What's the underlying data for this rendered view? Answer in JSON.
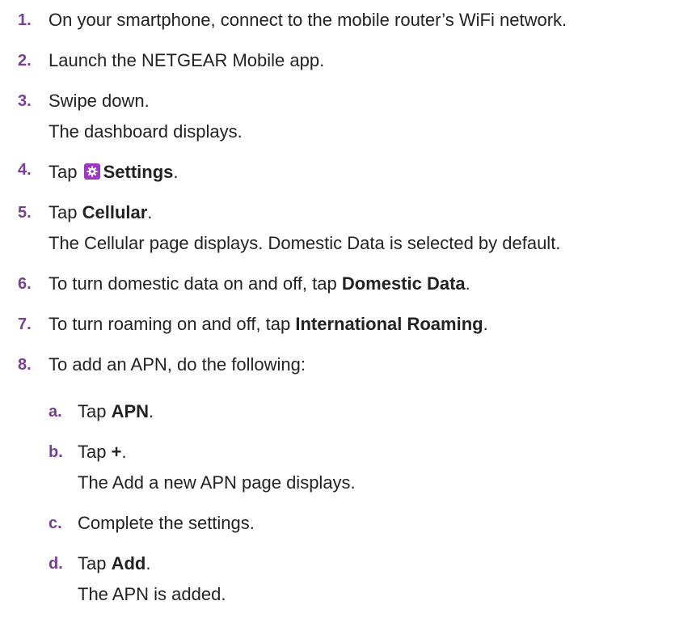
{
  "accent_color": "#7a3d98",
  "icon_color": "#9b39c5",
  "steps": [
    {
      "num": "1.",
      "text": "On your smartphone, connect to the mobile router’s WiFi network."
    },
    {
      "num": "2.",
      "text": "Launch the NETGEAR Mobile app."
    },
    {
      "num": "3.",
      "text": "Swipe down.",
      "result": "The dashboard displays."
    },
    {
      "num": "4.",
      "pre": "Tap",
      "icon": "settings-gear-icon",
      "bold": "Settings",
      "post": "."
    },
    {
      "num": "5.",
      "pre": "Tap ",
      "bold": "Cellular",
      "post": ".",
      "result": "The Cellular page displays. Domestic Data is selected by default."
    },
    {
      "num": "6.",
      "pre": "To turn domestic data on and off, tap ",
      "bold": "Domestic Data",
      "post": "."
    },
    {
      "num": "7.",
      "pre": "To turn roaming on and off, tap ",
      "bold": "International Roaming",
      "post": "."
    },
    {
      "num": "8.",
      "text": "To add an APN, do the following:"
    }
  ],
  "substeps": [
    {
      "num": "a.",
      "pre": "Tap ",
      "bold": "APN",
      "post": "."
    },
    {
      "num": "b.",
      "pre": "Tap ",
      "bold": "+",
      "post": ".",
      "result": "The Add a new APN page displays."
    },
    {
      "num": "c.",
      "text": "Complete the settings."
    },
    {
      "num": "d.",
      "pre": "Tap ",
      "bold": "Add",
      "post": ".",
      "result": "The APN is added."
    }
  ]
}
